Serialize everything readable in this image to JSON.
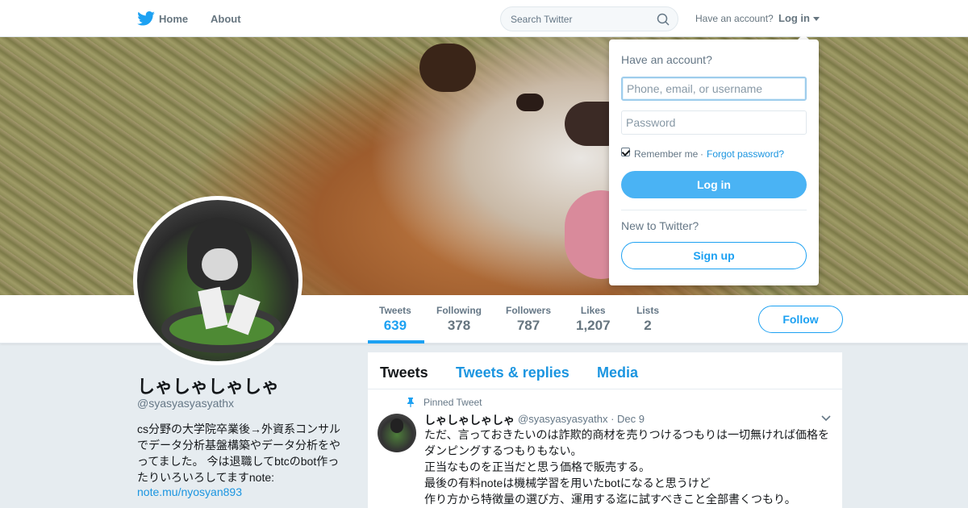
{
  "nav": {
    "logo_icon": "twitter-bird-icon",
    "home_label": "Home",
    "about_label": "About",
    "search_placeholder": "Search Twitter",
    "have_account": "Have an account?",
    "login_label": "Log in"
  },
  "stats": [
    {
      "label": "Tweets",
      "value": "639"
    },
    {
      "label": "Following",
      "value": "378"
    },
    {
      "label": "Followers",
      "value": "787"
    },
    {
      "label": "Likes",
      "value": "1,207"
    },
    {
      "label": "Lists",
      "value": "2"
    }
  ],
  "follow_label": "Follow",
  "profile": {
    "name": "しゃしゃしゃしゃ",
    "handle": "@syasyasyasyathx",
    "bio": "cs分野の大学院卒業後→外資系コンサルでデータ分析基盤構築やデータ分析をやってました。 今は退職してbtcのbot作ったりいろいろしてますnote:",
    "link": "note.mu/nyosyan893"
  },
  "timeline": {
    "tabs": [
      "Tweets",
      "Tweets & replies",
      "Media"
    ],
    "pinned_label": "Pinned Tweet",
    "tweet": {
      "name": "しゃしゃしゃしゃ",
      "meta": "@syasyasyasyathx · Dec 9",
      "lines": [
        "ただ、言っておきたいのは詐欺的商材を売りつけるつもりは一切無ければ価格をダンピングするつもりもない。",
        "正当なものを正当だと思う価格で販売する。",
        "最後の有料noteは機械学習を用いたbotになると思うけど",
        "作り方から特徴量の選び方、運用する迄に試すべきこと全部書くつもり。"
      ]
    }
  },
  "dropdown": {
    "title": "Have an account?",
    "username_placeholder": "Phone, email, or username",
    "password_placeholder": "Password",
    "remember_label": "Remember me",
    "separator": "·",
    "forgot_label": "Forgot password?",
    "login_button": "Log in",
    "new_label": "New to Twitter?",
    "signup_button": "Sign up"
  },
  "colors": {
    "accent": "#1da1f2",
    "login_button": "#4ab3f4",
    "page_bg": "#e6ecf0"
  }
}
